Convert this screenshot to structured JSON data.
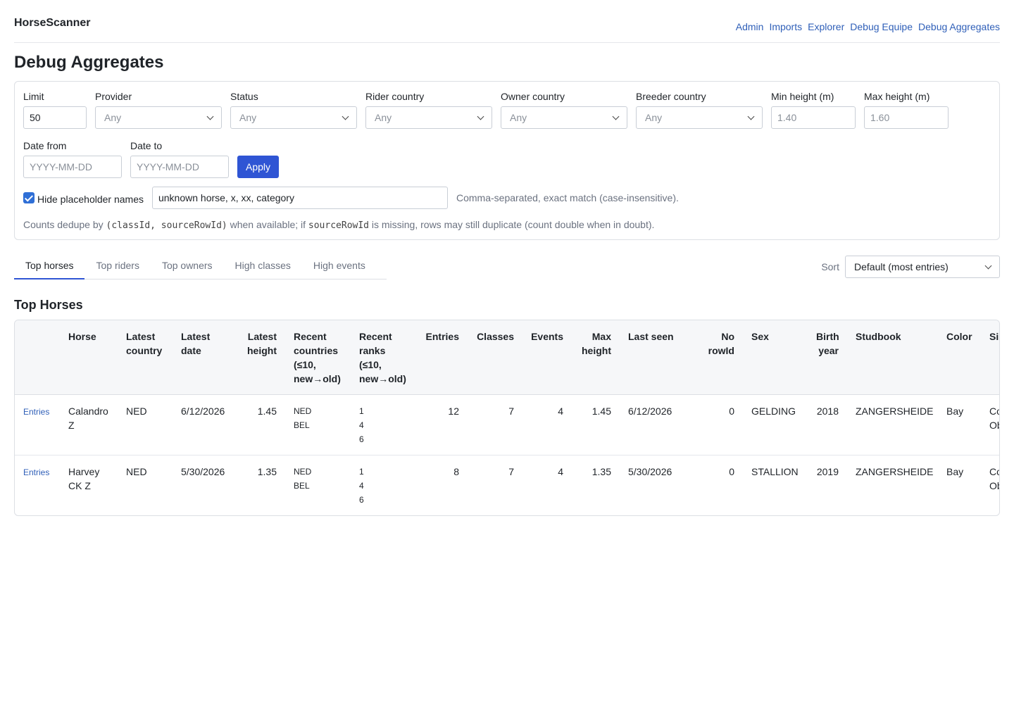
{
  "app": {
    "brand": "HorseScanner"
  },
  "nav": [
    "Admin",
    "Imports",
    "Explorer",
    "Debug Equipe",
    "Debug Aggregates"
  ],
  "page_title": "Debug Aggregates",
  "filters": {
    "limit": {
      "label": "Limit",
      "value": "50"
    },
    "provider": {
      "label": "Provider",
      "value": "Any"
    },
    "status": {
      "label": "Status",
      "value": "Any"
    },
    "rider_country": {
      "label": "Rider country",
      "value": "Any"
    },
    "owner_country": {
      "label": "Owner country",
      "value": "Any"
    },
    "breeder_country": {
      "label": "Breeder country",
      "value": "Any"
    },
    "min_height": {
      "label": "Min height (m)",
      "placeholder": "1.40"
    },
    "max_height": {
      "label": "Max height (m)",
      "placeholder": "1.60"
    },
    "date_from": {
      "label": "Date from",
      "placeholder": "YYYY-MM-DD"
    },
    "date_to": {
      "label": "Date to",
      "placeholder": "YYYY-MM-DD"
    },
    "apply_label": "Apply",
    "hide_placeholder": {
      "label": "Hide placeholder names",
      "checked": true,
      "value": "unknown horse, x, xx, category",
      "note": "Comma-separated, exact match (case-insensitive)."
    },
    "info": {
      "pre": "Counts dedupe by ",
      "code1": "(classId, sourceRowId)",
      "mid": " when available; if ",
      "code2": "sourceRowId",
      "post": " is missing, rows may still duplicate (count double when in doubt)."
    }
  },
  "tabs": [
    "Top horses",
    "Top riders",
    "Top owners",
    "High classes",
    "High events"
  ],
  "active_tab": "Top horses",
  "sort": {
    "label": "Sort",
    "value": "Default (most entries)"
  },
  "section_title": "Top Horses",
  "table": {
    "columns": [
      "",
      "Horse",
      "Latest country",
      "Latest date",
      "Latest height",
      "Recent countries (≤10, new→old)",
      "Recent ranks (≤10, new→old)",
      "Entries",
      "Classes",
      "Events",
      "Max height",
      "Last seen",
      "No rowId",
      "Sex",
      "Birth year",
      "Studbook",
      "Color",
      "Sire"
    ],
    "rows": [
      {
        "link": "Entries",
        "horse": "Calandro Z",
        "latest_country": "NED",
        "latest_date": "6/12/2026",
        "latest_height": "1.45",
        "recent_countries": [
          "NED",
          "BEL"
        ],
        "recent_ranks": [
          "1",
          "4",
          "6"
        ],
        "entries": "12",
        "classes": "7",
        "events": "4",
        "max_height": "1.45",
        "last_seen": "6/12/2026",
        "no_rowid": "0",
        "sex": "GELDING",
        "birth_year": "2018",
        "studbook": "ZANGERSHEIDE",
        "color": "Bay",
        "sire": "Cornet Obolensky"
      },
      {
        "link": "Entries",
        "horse": "Harvey CK Z",
        "latest_country": "NED",
        "latest_date": "5/30/2026",
        "latest_height": "1.35",
        "recent_countries": [
          "NED",
          "BEL"
        ],
        "recent_ranks": [
          "1",
          "4",
          "6"
        ],
        "entries": "8",
        "classes": "7",
        "events": "4",
        "max_height": "1.35",
        "last_seen": "5/30/2026",
        "no_rowid": "0",
        "sex": "STALLION",
        "birth_year": "2019",
        "studbook": "ZANGERSHEIDE",
        "color": "Bay",
        "sire": "Cornet Obolensky"
      }
    ]
  }
}
